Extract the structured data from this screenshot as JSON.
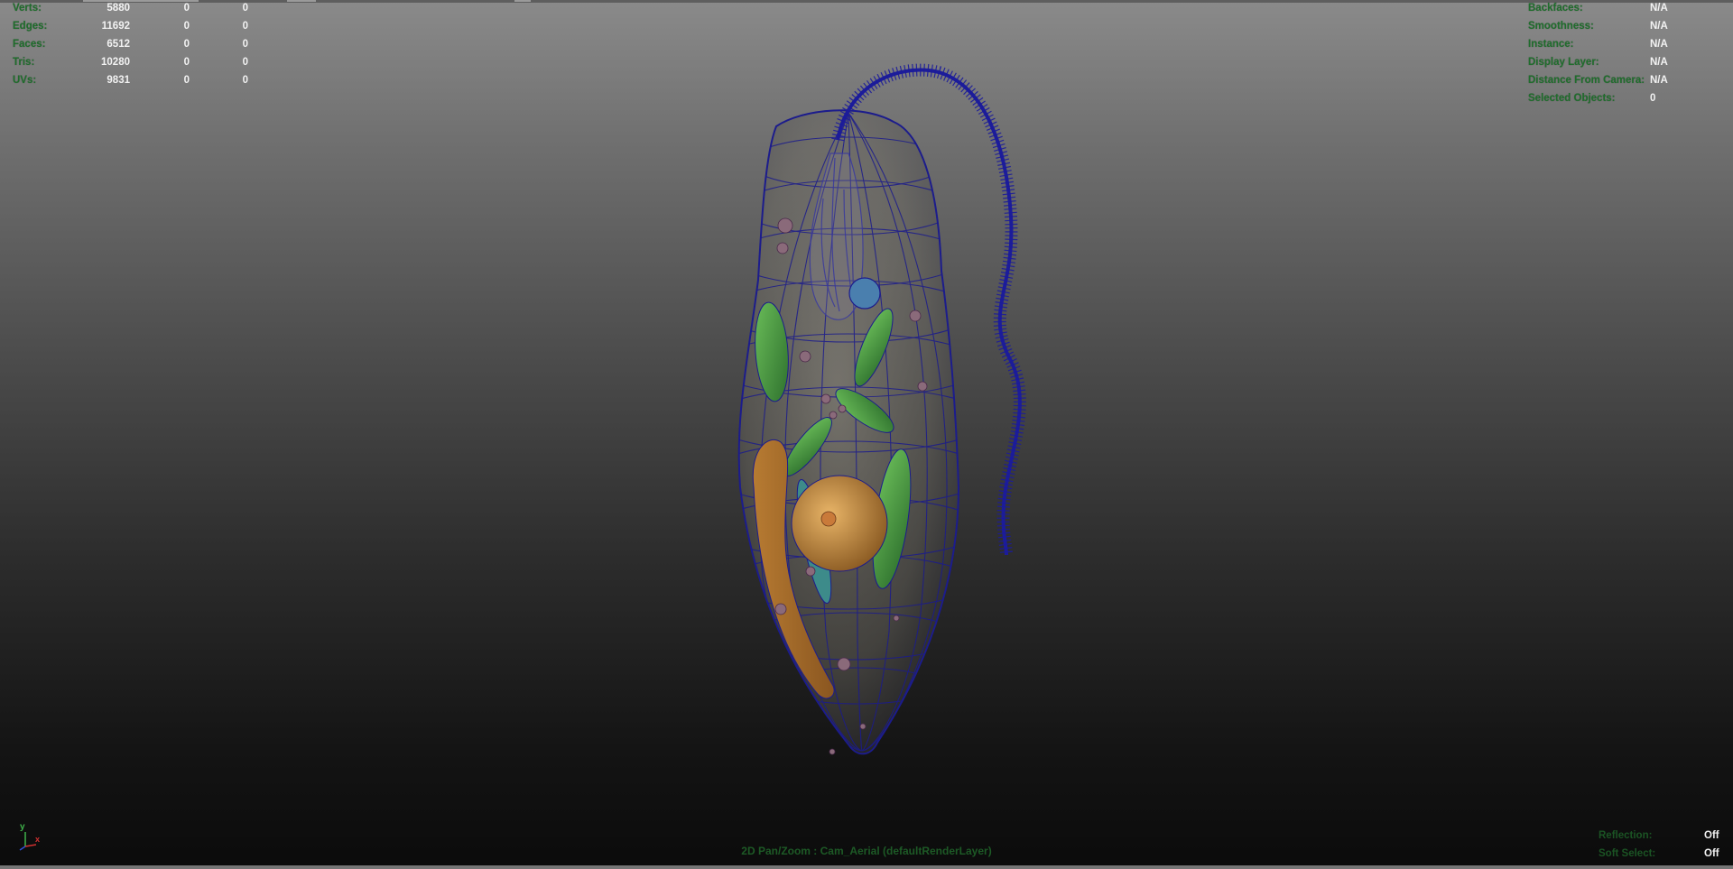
{
  "poly_count": {
    "rows": [
      {
        "label": "Verts:",
        "values": [
          "5880",
          "0",
          "0"
        ]
      },
      {
        "label": "Edges:",
        "values": [
          "11692",
          "0",
          "0"
        ]
      },
      {
        "label": "Faces:",
        "values": [
          "6512",
          "0",
          "0"
        ]
      },
      {
        "label": "Tris:",
        "values": [
          "10280",
          "0",
          "0"
        ]
      },
      {
        "label": "UVs:",
        "values": [
          "9831",
          "0",
          "0"
        ]
      }
    ]
  },
  "object_details": {
    "rows": [
      {
        "label": "Backfaces:",
        "value": "N/A"
      },
      {
        "label": "Smoothness:",
        "value": "N/A"
      },
      {
        "label": "Instance:",
        "value": "N/A"
      },
      {
        "label": "Display Layer:",
        "value": "N/A"
      },
      {
        "label": "Distance From Camera:",
        "value": "N/A"
      },
      {
        "label": "Selected Objects:",
        "value": "0"
      }
    ]
  },
  "viewport_status": {
    "rows": [
      {
        "label": "Reflection:",
        "value": "Off"
      },
      {
        "label": "Soft Select:",
        "value": "Off"
      }
    ]
  },
  "camera_label": "2D Pan/Zoom : Cam_Aerial (defaultRenderLayer)",
  "axis_gizmo": {
    "y_label": "y",
    "x_label": "x"
  },
  "colors": {
    "hud_green": "#1f6e2c",
    "hud_value_white": "#f2f2f2",
    "wireframe_blue": "#1c1c8c",
    "chloroplast_green": "#3f8f3a",
    "nucleus_orange": "#c98a35"
  }
}
